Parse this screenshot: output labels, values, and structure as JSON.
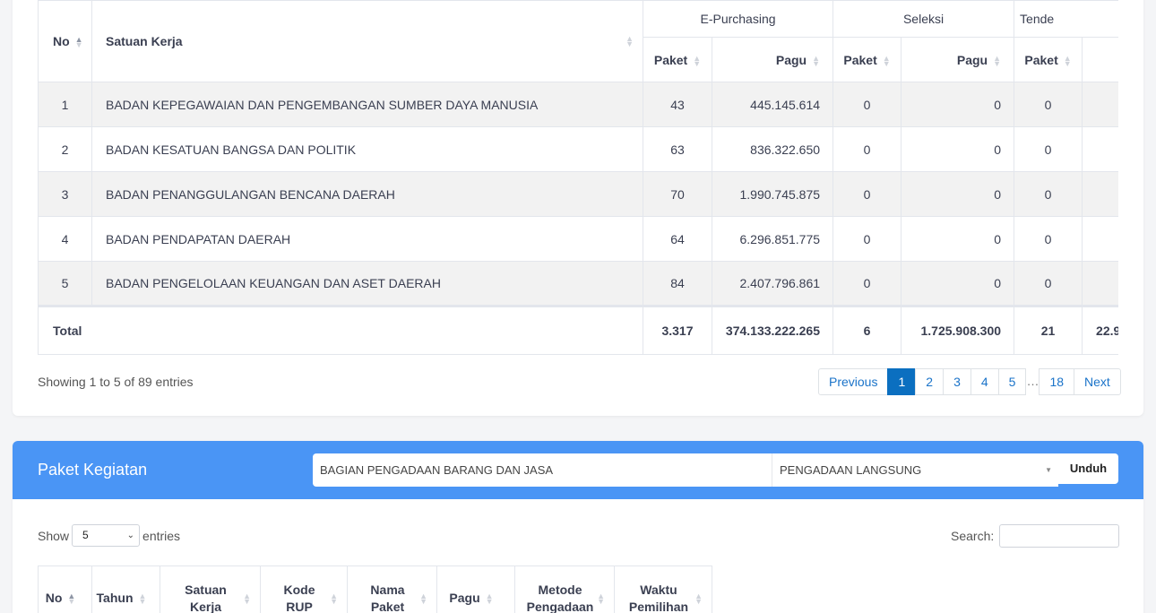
{
  "summary_table": {
    "headers": {
      "no": "No",
      "satuan_kerja": "Satuan Kerja",
      "e_purchasing": "E-Purchasing",
      "seleksi": "Seleksi",
      "tender": "Tende",
      "paket": "Paket",
      "pagu": "Pagu"
    },
    "rows": [
      {
        "no": "1",
        "satuan_kerja": "BADAN KEPEGAWAIAN DAN PENGEMBANGAN SUMBER DAYA MANUSIA",
        "ep_paket": "43",
        "ep_pagu": "445.145.614",
        "sel_paket": "0",
        "sel_pagu": "0",
        "ten_paket": "0"
      },
      {
        "no": "2",
        "satuan_kerja": "BADAN KESATUAN BANGSA DAN POLITIK",
        "ep_paket": "63",
        "ep_pagu": "836.322.650",
        "sel_paket": "0",
        "sel_pagu": "0",
        "ten_paket": "0"
      },
      {
        "no": "3",
        "satuan_kerja": "BADAN PENANGGULANGAN BENCANA DAERAH",
        "ep_paket": "70",
        "ep_pagu": "1.990.745.875",
        "sel_paket": "0",
        "sel_pagu": "0",
        "ten_paket": "0"
      },
      {
        "no": "4",
        "satuan_kerja": "BADAN PENDAPATAN DAERAH",
        "ep_paket": "64",
        "ep_pagu": "6.296.851.775",
        "sel_paket": "0",
        "sel_pagu": "0",
        "ten_paket": "0"
      },
      {
        "no": "5",
        "satuan_kerja": "BADAN PENGELOLAAN KEUANGAN DAN ASET DAERAH",
        "ep_paket": "84",
        "ep_pagu": "2.407.796.861",
        "sel_paket": "0",
        "sel_pagu": "0",
        "ten_paket": "0"
      }
    ],
    "total": {
      "label": "Total",
      "ep_paket": "3.317",
      "ep_pagu": "374.133.222.265",
      "sel_paket": "6",
      "sel_pagu": "1.725.908.300",
      "ten_paket": "21",
      "ten_pagu": "22.9"
    },
    "info": "Showing 1 to 5 of 89 entries",
    "pagination": {
      "previous": "Previous",
      "pages": [
        "1",
        "2",
        "3",
        "4",
        "5"
      ],
      "ellipsis": "…",
      "last": "18",
      "next": "Next",
      "active": "1"
    }
  },
  "paket_kegiatan": {
    "title": "Paket Kegiatan",
    "satker_select": "BAGIAN PENGADAAN BARANG DAN JASA",
    "metode_select": "PENGADAAN LANGSUNG",
    "download_label": "Unduh",
    "show_label": "Show",
    "show_value": "5",
    "entries_label": "entries",
    "search_label": "Search:",
    "search_value": "",
    "columns": {
      "no": "No",
      "tahun": "Tahun",
      "satuan_kerja_1": "Satuan",
      "satuan_kerja_2": "Kerja",
      "kode_rup_1": "Kode",
      "kode_rup_2": "RUP",
      "nama_paket_1": "Nama",
      "nama_paket_2": "Paket",
      "pagu": "Pagu",
      "metode_pengadaan_1": "Metode",
      "metode_pengadaan_2": "Pengadaan",
      "waktu_pemilihan_1": "Waktu",
      "waktu_pemilihan_2": "Pemilihan"
    }
  },
  "colors": {
    "accent_blue": "#4a95f5",
    "pager_active": "#0b6fc0",
    "link_blue": "#1a73c9"
  },
  "icons": {
    "sort": "sort-arrows-icon",
    "caret": "caret-down-icon"
  }
}
